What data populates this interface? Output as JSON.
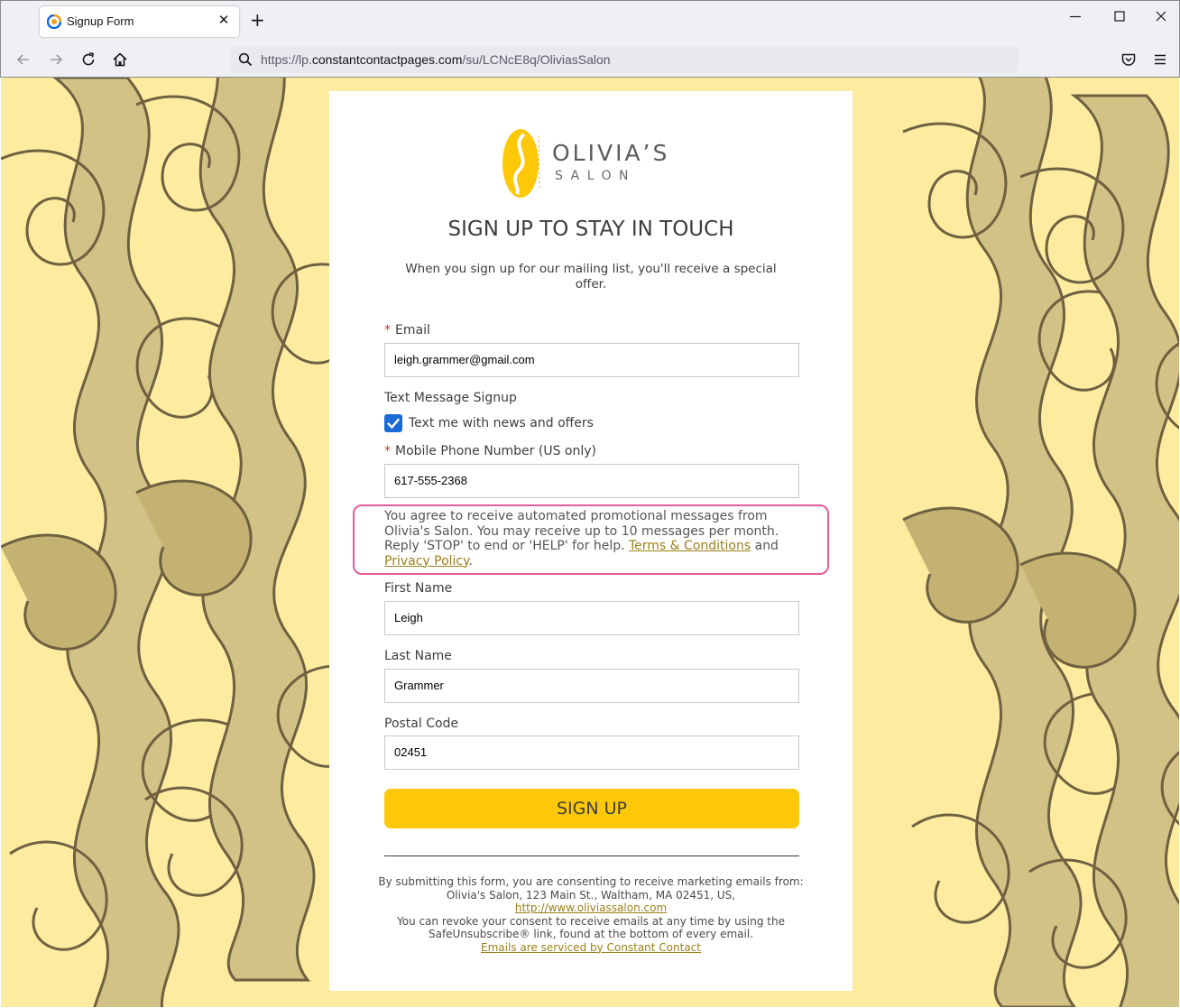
{
  "browser": {
    "tab_title": "Signup Form",
    "url_prefix": "https://lp.",
    "url_domain": "constantcontactpages.com",
    "url_path": "/su/LCNcE8q/OliviasSalon"
  },
  "logo": {
    "line1": "OLIVIA’S",
    "line2": "SALON"
  },
  "form": {
    "title": "SIGN UP TO STAY IN TOUCH",
    "intro": "When you sign up for our mailing list, you'll receive a special offer.",
    "required_mark": "*",
    "email_label": "Email",
    "email_value": "leigh.grammer@gmail.com",
    "sms_heading": "Text Message Signup",
    "sms_checkbox_label": "Text me with news and offers",
    "sms_checked": true,
    "phone_label": "Mobile Phone Number (US only)",
    "phone_value": "617-555-2368",
    "consent_text": "You agree to receive automated promotional messages from Olivia's Salon. You may receive up to 10 messages per month. Reply 'STOP' to end or 'HELP' for help.",
    "terms_link": "Terms & Conditions",
    "and_text": "and",
    "privacy_link": "Privacy Policy",
    "period": ".",
    "first_name_label": "First Name",
    "first_name_value": "Leigh",
    "last_name_label": "Last Name",
    "last_name_value": "Grammer",
    "postal_label": "Postal Code",
    "postal_value": "02451",
    "submit_label": "SIGN UP"
  },
  "footer": {
    "line1": "By submitting this form, you are consenting to receive marketing emails from: Olivia's Salon, 123 Main St., Waltham, MA 02451, US,",
    "site_link": "http://www.oliviassalon.com",
    "line2": "You can revoke your consent to receive emails at any time by using the SafeUnsubscribe® link, found at the bottom of every email.",
    "service_link": "Emails are serviced by Constant Contact"
  },
  "colors": {
    "background": "#fdeca0",
    "pattern_fill": "#d3c285",
    "pattern_stroke": "#6e6040",
    "button": "#fdc808",
    "highlight": "#e55c9b",
    "link": "#9c8019",
    "checkbox": "#1a6ad8"
  },
  "icons": [
    "firefox-tab-icon",
    "close-icon",
    "plus-icon",
    "minimize-icon",
    "maximize-icon",
    "window-close-icon",
    "back-icon",
    "forward-icon",
    "reload-icon",
    "home-icon",
    "search-icon",
    "pocket-icon",
    "menu-icon",
    "checkmark-icon"
  ]
}
